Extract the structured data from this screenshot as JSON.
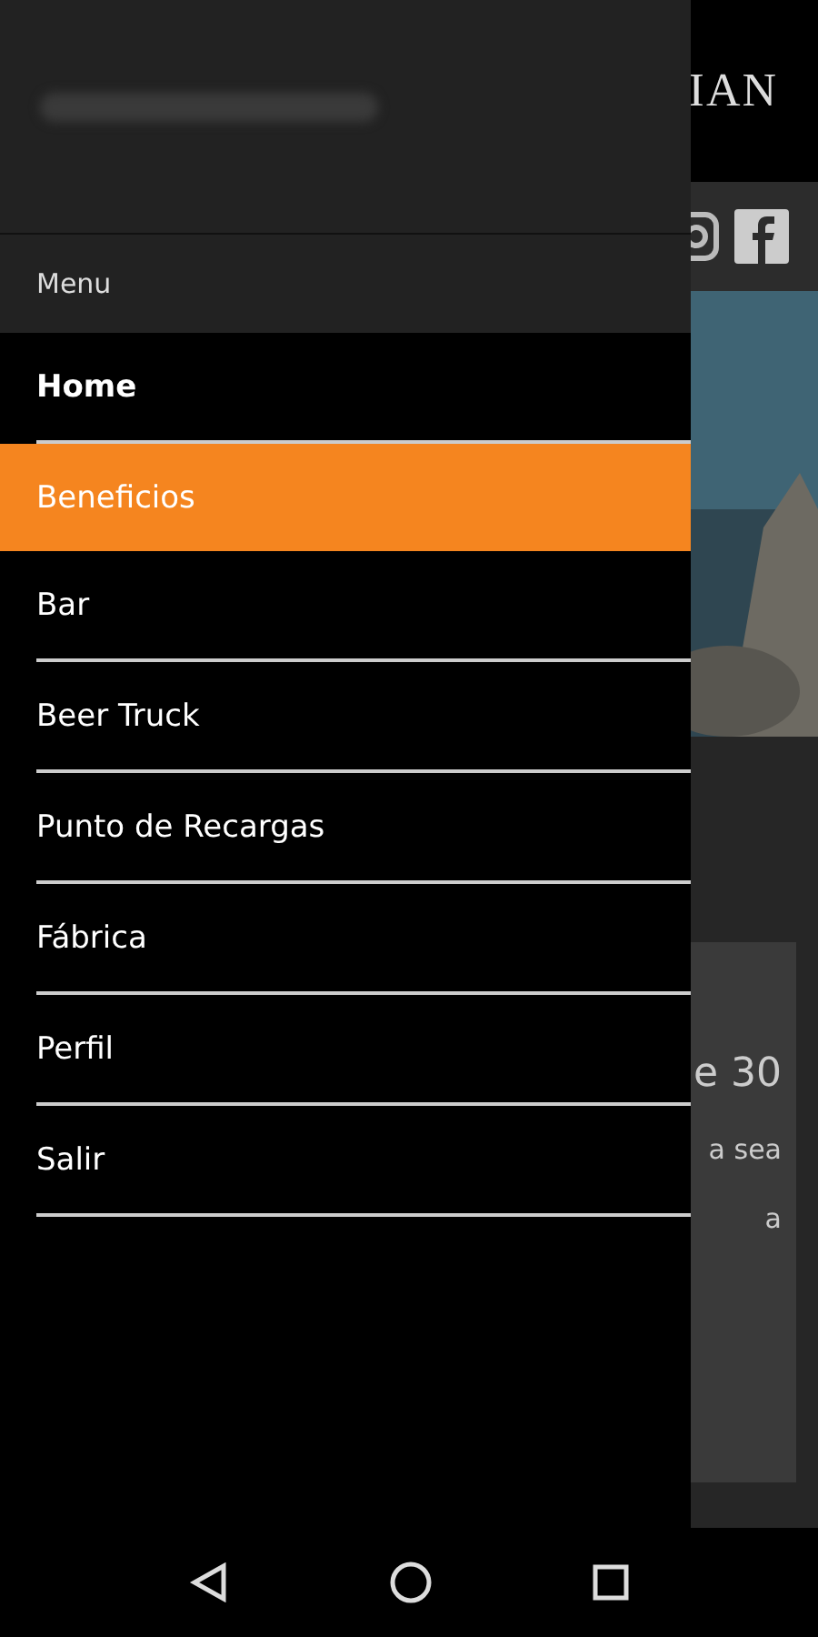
{
  "page": {
    "header_title": "IAN",
    "card_texts": [
      "e 30",
      "a sea",
      "a"
    ]
  },
  "drawer": {
    "section_label": "Menu",
    "items": [
      {
        "label": "Home",
        "selected": false,
        "bold": true
      },
      {
        "label": "Beneficios",
        "selected": true,
        "bold": false
      },
      {
        "label": "Bar",
        "selected": false,
        "bold": false
      },
      {
        "label": "Beer Truck",
        "selected": false,
        "bold": false
      },
      {
        "label": "Punto de Recargas",
        "selected": false,
        "bold": false
      },
      {
        "label": "Fábrica",
        "selected": false,
        "bold": false
      },
      {
        "label": "Perfil",
        "selected": false,
        "bold": false
      },
      {
        "label": "Salir",
        "selected": false,
        "bold": false
      }
    ]
  }
}
